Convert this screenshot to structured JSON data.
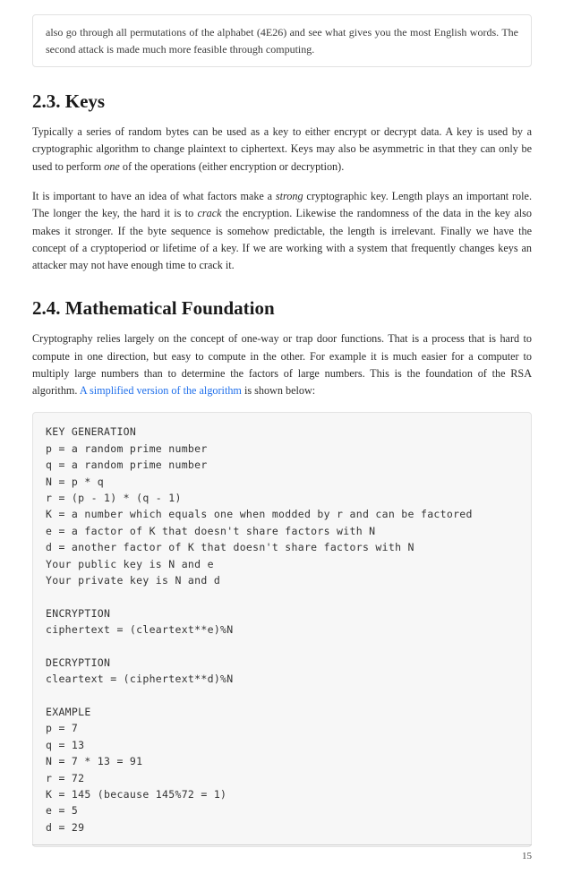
{
  "note": {
    "text": "also go through all permutations of the alphabet (4E26) and see what gives you the most English words. The second attack is made much more feasible through computing."
  },
  "sections": {
    "keys_heading": "2.3. Keys",
    "keys_p1_a": "Typically a series of random bytes can be used as a key to either encrypt or decrypt data. A key is used by a cryptographic algorithm to change plaintext to ciphertext. Keys may also be asymmetric in that they can only be used to perform ",
    "keys_p1_em": "one",
    "keys_p1_b": " of the operations (either encryption or decryption).",
    "keys_p2_a": "It is important to have an idea of what factors make a ",
    "keys_p2_em1": "strong",
    "keys_p2_b": " cryptographic key. Length plays an important role. The longer the key, the hard it is to ",
    "keys_p2_em2": "crack",
    "keys_p2_c": " the encryption. Likewise the randomness of the data in the key also makes it stronger. If the byte sequence is somehow predictable, the length is irrelevant. Finally we have the concept of a cryptoperiod or lifetime of a key. If we are working with a system that frequently changes keys an attacker may not have enough time to crack it.",
    "math_heading": "2.4. Mathematical Foundation",
    "math_p1_a": "Cryptography relies largely on the concept of one-way or trap door functions. That is a process that is hard to compute in one direction, but easy to compute in the other. For example it is much easier for a computer to multiply large numbers than to determine the factors of large numbers. This is the foundation of the RSA algorithm. ",
    "math_link": "A simplified version of the algorithm",
    "math_p1_b": " is shown below:"
  },
  "code": "KEY GENERATION\np = a random prime number\nq = a random prime number\nN = p * q\nr = (p - 1) * (q - 1)\nK = a number which equals one when modded by r and can be factored\ne = a factor of K that doesn't share factors with N\nd = another factor of K that doesn't share factors with N\nYour public key is N and e\nYour private key is N and d\n\nENCRYPTION\nciphertext = (cleartext**e)%N\n\nDECRYPTION\ncleartext = (ciphertext**d)%N\n\nEXAMPLE\np = 7\nq = 13\nN = 7 * 13 = 91\nr = 72\nK = 145 (because 145%72 = 1)\ne = 5\nd = 29",
  "page_number": "15"
}
